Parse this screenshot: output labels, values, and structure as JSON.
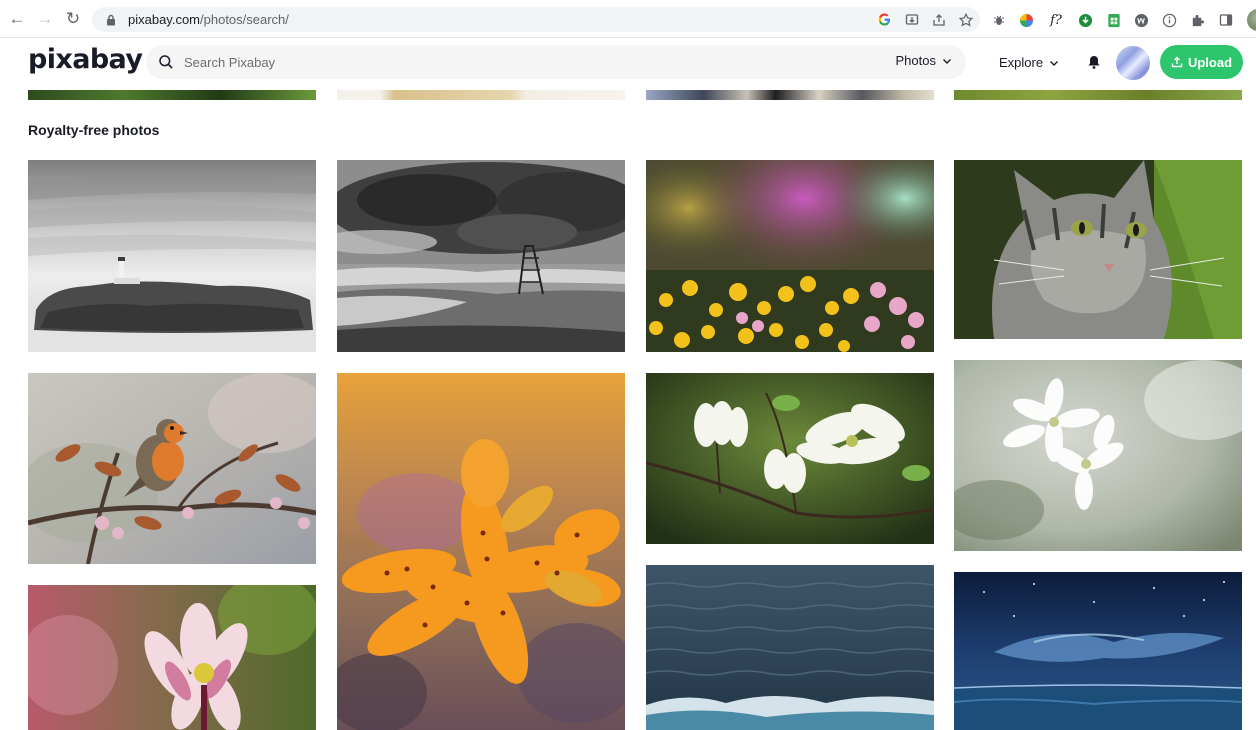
{
  "browser": {
    "url_host": "pixabay.com",
    "url_path": "/photos/search/",
    "omnibox_icons": [
      "google-icon",
      "install-icon",
      "share-icon",
      "star-icon"
    ],
    "extensions": [
      "bug-icon",
      "color-wheel-icon",
      "formula-icon",
      "download-icon",
      "spreadsheet-icon",
      "w-icon",
      "info-icon",
      "puzzle-icon",
      "sidebar-icon"
    ],
    "formula_label": "f?"
  },
  "header": {
    "logo": "pixabay",
    "search_placeholder": "Search Pixabay",
    "filter_label": "Photos",
    "explore_label": "Explore",
    "upload_label": "Upload",
    "brand_green": "#2ec66d"
  },
  "section": {
    "title": "Royalty-free photos"
  },
  "photos": [
    {
      "subject": "lighthouse-island"
    },
    {
      "subject": "stormy-beach"
    },
    {
      "subject": "meadow-flowers"
    },
    {
      "subject": "tabby-cat"
    },
    {
      "subject": "robin-on-branch"
    },
    {
      "subject": "orange-lily"
    },
    {
      "subject": "white-dogwood"
    },
    {
      "subject": "white-blossom"
    },
    {
      "subject": "pink-columbine"
    },
    {
      "subject": "ocean-waves"
    },
    {
      "subject": "night-sky-sea"
    }
  ]
}
